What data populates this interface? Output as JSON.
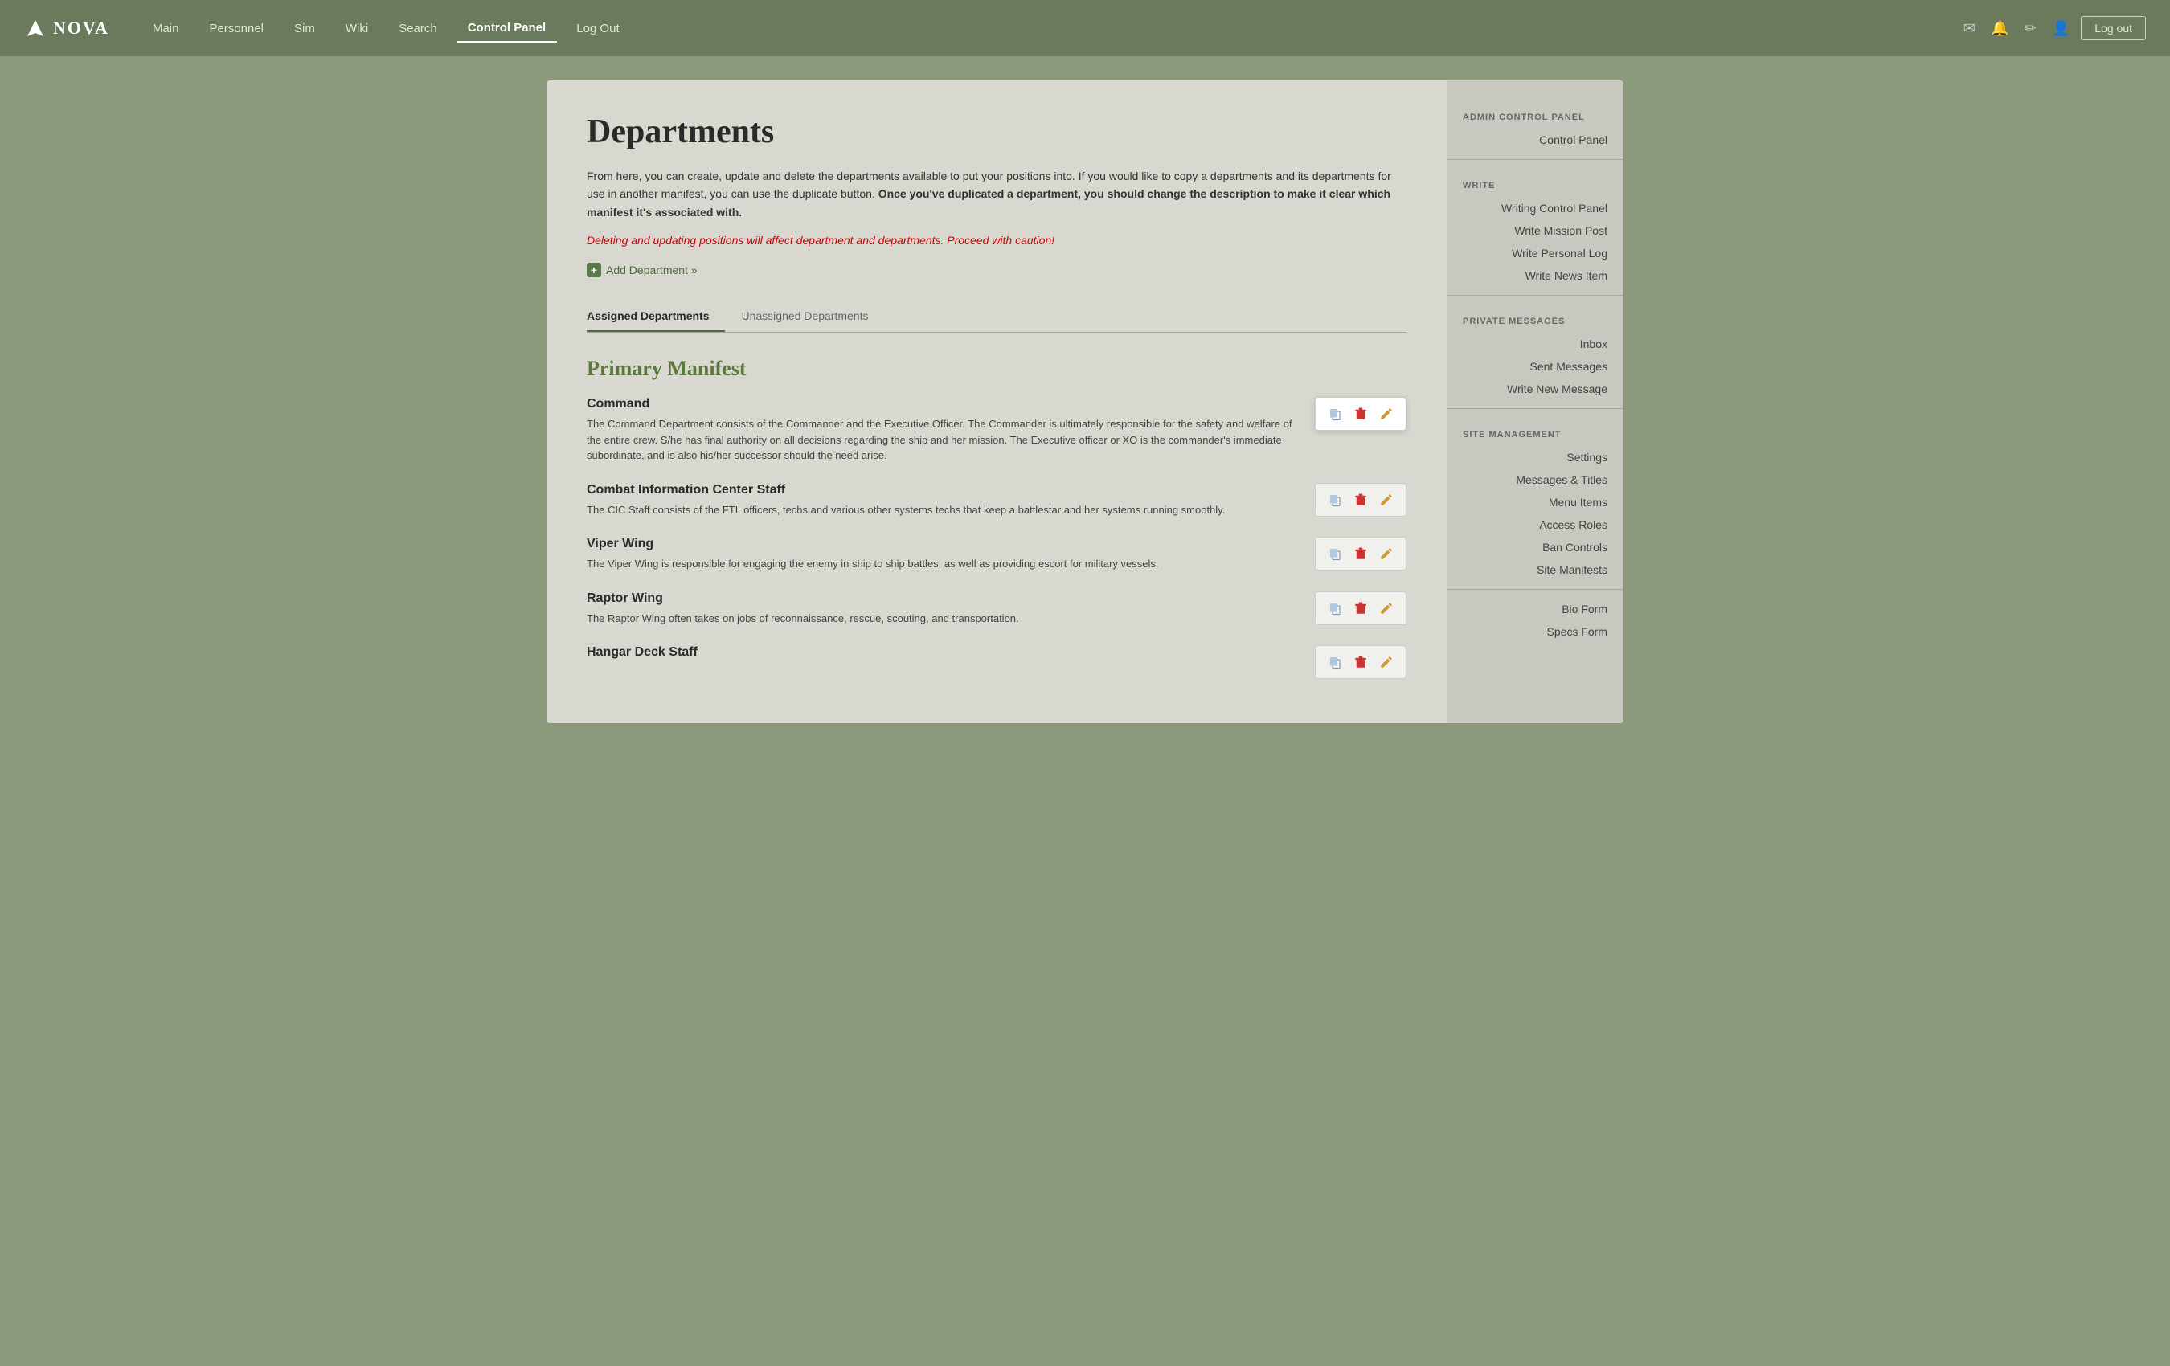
{
  "nav": {
    "logo": "NOVA",
    "links": [
      {
        "label": "Main",
        "active": false
      },
      {
        "label": "Personnel",
        "active": false
      },
      {
        "label": "Sim",
        "active": false
      },
      {
        "label": "Wiki",
        "active": false
      },
      {
        "label": "Search",
        "active": false
      },
      {
        "label": "Control Panel",
        "active": true
      },
      {
        "label": "Log Out",
        "active": false
      }
    ],
    "logout_label": "Log out"
  },
  "page": {
    "title": "Departments",
    "description1": "From here, you can create, update and delete the departments available to put your positions into. If you would like to copy a departments and its departments for use in another manifest, you can use the duplicate button.",
    "description2": "Once you've duplicated a department, you should change the description to make it clear which manifest it's associated with.",
    "warning": "Deleting and updating positions will affect department and departments. Proceed with caution!",
    "add_department": "Add Department »"
  },
  "tabs": [
    {
      "label": "Assigned Departments",
      "active": true
    },
    {
      "label": "Unassigned Departments",
      "active": false
    }
  ],
  "manifest": {
    "title": "Primary Manifest",
    "departments": [
      {
        "name": "Command",
        "description": "The Command Department consists of the Commander and the Executive Officer. The Commander is ultimately responsible for the safety and welfare of the entire crew. S/he has final authority on all decisions regarding the ship and her mission. The Executive officer or XO is the commander's immediate subordinate, and is also his/her successor should the need arise.",
        "highlighted": true
      },
      {
        "name": "Combat Information Center Staff",
        "description": "The CIC Staff consists of the FTL officers, techs and various other systems techs that keep a battlestar and her systems running smoothly.",
        "highlighted": false
      },
      {
        "name": "Viper Wing",
        "description": "The Viper Wing is responsible for engaging the enemy in ship to ship battles, as well as providing escort for military vessels.",
        "highlighted": false
      },
      {
        "name": "Raptor Wing",
        "description": "The Raptor Wing often takes on jobs of reconnaissance, rescue, scouting, and transportation.",
        "highlighted": false
      },
      {
        "name": "Hangar Deck Staff",
        "description": "",
        "highlighted": false
      }
    ]
  },
  "sidebar": {
    "admin_section": "ADMIN CONTROL PANEL",
    "admin_links": [
      {
        "label": "Control Panel"
      }
    ],
    "write_section": "WRITE",
    "write_links": [
      {
        "label": "Writing Control Panel"
      },
      {
        "label": "Write Mission Post"
      },
      {
        "label": "Write Personal Log"
      },
      {
        "label": "Write News Item"
      }
    ],
    "pm_section": "PRIVATE MESSAGES",
    "pm_links": [
      {
        "label": "Inbox"
      },
      {
        "label": "Sent Messages"
      },
      {
        "label": "Write New Message"
      }
    ],
    "site_section": "SITE MANAGEMENT",
    "site_links": [
      {
        "label": "Settings"
      },
      {
        "label": "Messages & Titles"
      },
      {
        "label": "Menu Items"
      },
      {
        "label": "Access Roles"
      },
      {
        "label": "Ban Controls"
      },
      {
        "label": "Site Manifests"
      }
    ],
    "extra_links": [
      {
        "label": "Bio Form"
      },
      {
        "label": "Specs Form"
      }
    ]
  },
  "icons": {
    "copy": "📋",
    "delete": "🗑",
    "edit": "✏"
  }
}
